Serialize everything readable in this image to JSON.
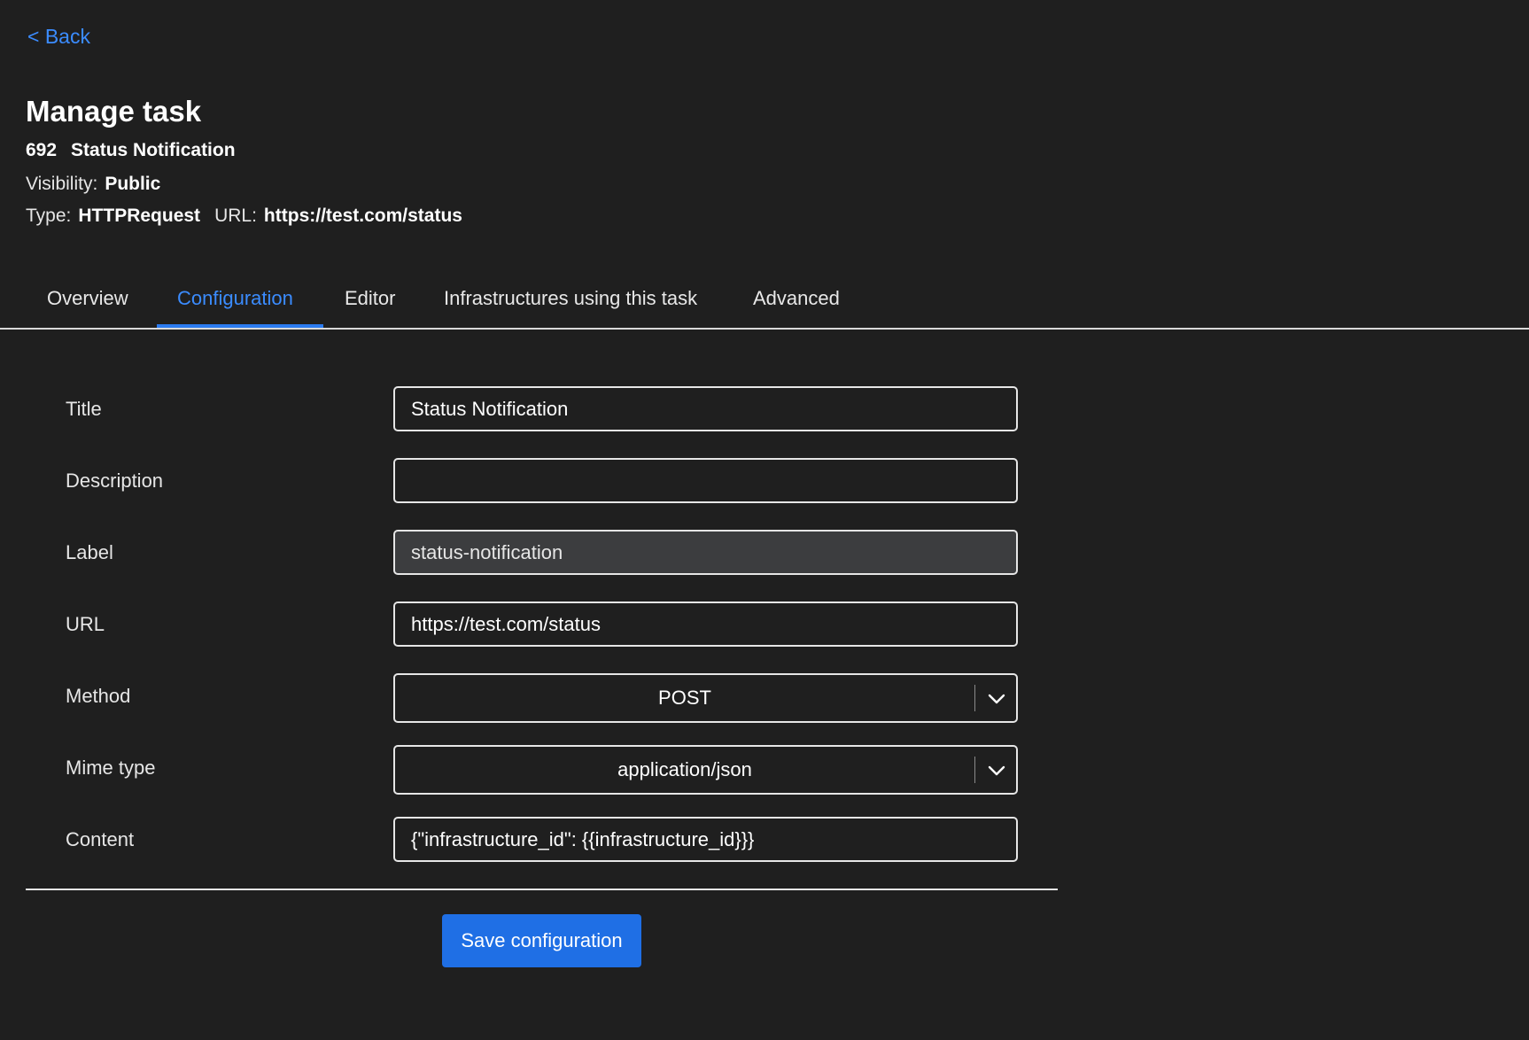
{
  "nav": {
    "back_label": "< Back"
  },
  "header": {
    "title": "Manage task",
    "task_id": "692",
    "task_name": "Status Notification",
    "visibility_label": "Visibility:",
    "visibility_value": "Public",
    "type_label": "Type:",
    "type_value": "HTTPRequest",
    "url_label": "URL:",
    "url_value": "https://test.com/status"
  },
  "tabs": [
    {
      "label": "Overview",
      "active": false
    },
    {
      "label": "Configuration",
      "active": true
    },
    {
      "label": "Editor",
      "active": false
    },
    {
      "label": "Infrastructures using this task",
      "active": false
    },
    {
      "label": "Advanced",
      "active": false
    }
  ],
  "form": {
    "title": {
      "label": "Title",
      "value": "Status Notification"
    },
    "description": {
      "label": "Description",
      "value": ""
    },
    "label": {
      "label": "Label",
      "value": "status-notification",
      "disabled": true
    },
    "url": {
      "label": "URL",
      "value": "https://test.com/status"
    },
    "method": {
      "label": "Method",
      "value": "POST"
    },
    "mime_type": {
      "label": "Mime type",
      "value": "application/json"
    },
    "content": {
      "label": "Content",
      "value": "{\"infrastructure_id\": {{infrastructure_id}}}"
    }
  },
  "actions": {
    "save_label": "Save configuration"
  },
  "colors": {
    "background": "#1f1f1f",
    "accent": "#3b8cff",
    "button": "#1f6fe5",
    "disabled_input": "#3c3d3f"
  },
  "icons": {
    "select_chevron": "chevron-down-icon"
  }
}
